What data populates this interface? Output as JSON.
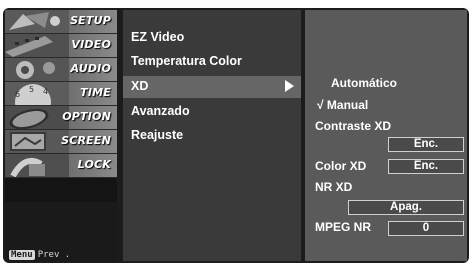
{
  "categories": [
    {
      "label": "SETUP",
      "icon": "setup-satellite-icon"
    },
    {
      "label": "VIDEO",
      "icon": "video-film-icon"
    },
    {
      "label": "AUDIO",
      "icon": "audio-speaker-icon"
    },
    {
      "label": "TIME",
      "icon": "time-clock-icon"
    },
    {
      "label": "OPTION",
      "icon": "option-tag-icon"
    },
    {
      "label": "SCREEN",
      "icon": "screen-monitor-icon"
    },
    {
      "label": "LOCK",
      "icon": "lock-padlock-icon"
    }
  ],
  "footer": {
    "menu_key": "Menu",
    "prev_label": "Prev ."
  },
  "submenu": {
    "items": [
      "EZ Video",
      "Temperatura Color",
      "XD",
      "Avanzado",
      "Reajuste"
    ],
    "selected": "XD"
  },
  "options": {
    "mode_auto": "Automático",
    "mode_manual": "√ Manual",
    "contraste_label": "Contraste XD",
    "contraste_value": "Enc.",
    "color_label": "Color XD",
    "color_value": "Enc.",
    "nr_label": "NR XD",
    "nr_value": "Apag.",
    "mpeg_label": "MPEG NR",
    "mpeg_value": "0"
  },
  "colors": {
    "panel_dark": "#1c1c1c",
    "submenu_bg": "#3a3a3a",
    "highlight": "#666666",
    "option_bg": "#5a5a5a"
  }
}
